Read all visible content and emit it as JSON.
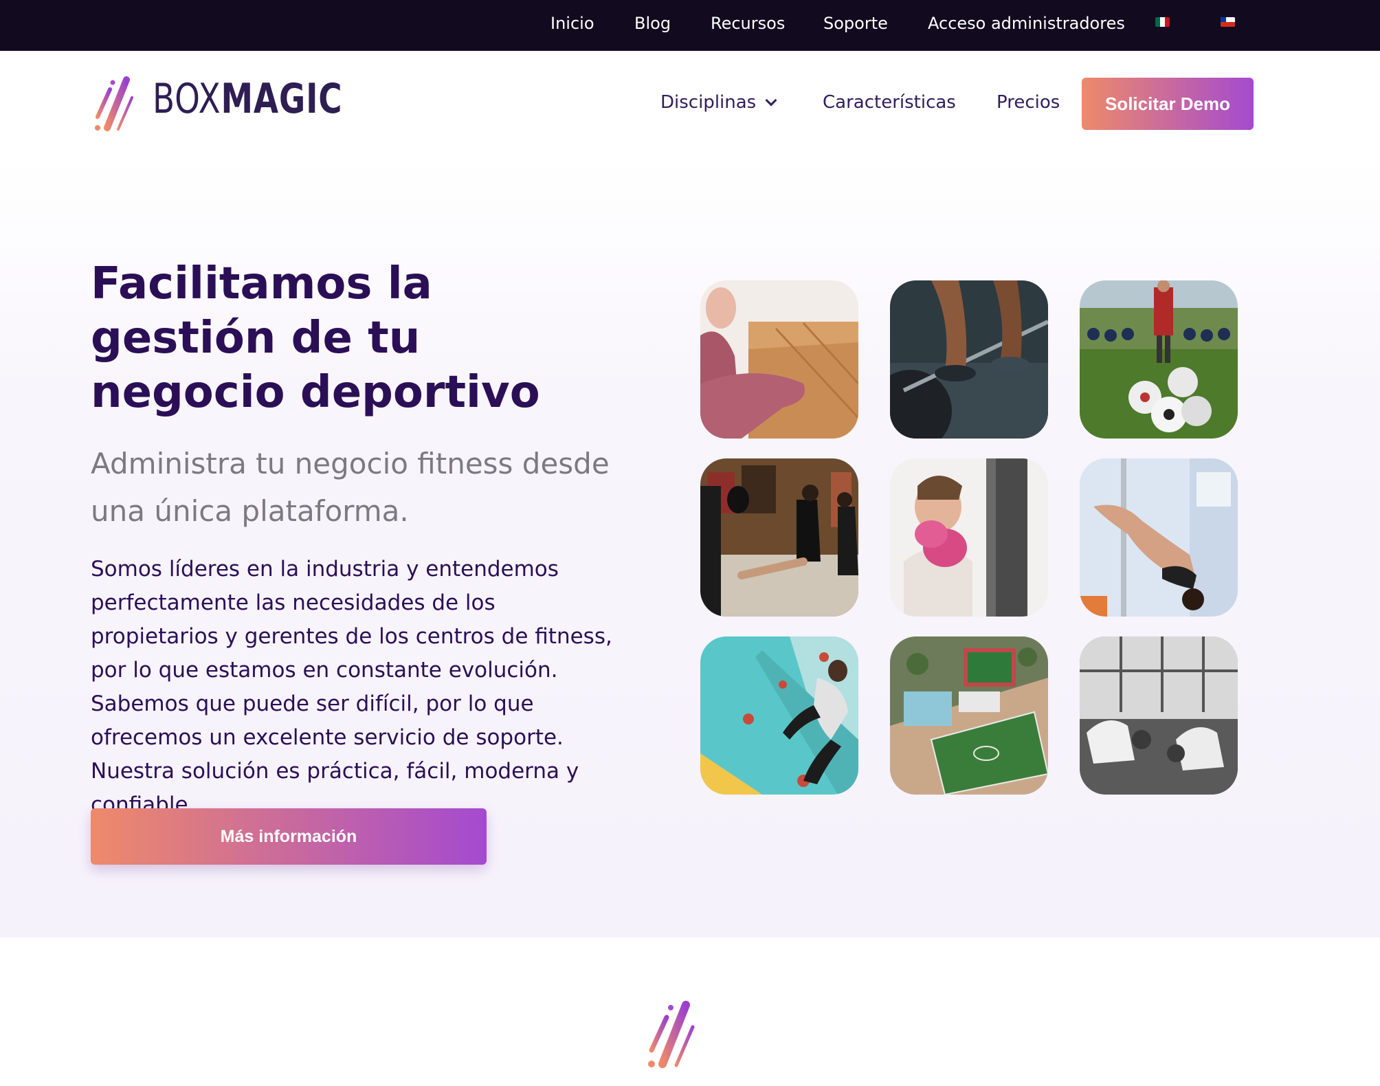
{
  "topbar": {
    "links": [
      "Inicio",
      "Blog",
      "Recursos",
      "Soporte",
      "Acceso administradores"
    ],
    "flags": [
      "mexico-flag-icon",
      "chile-flag-icon"
    ]
  },
  "header": {
    "logo": {
      "light": "BOX",
      "bold": "MAGIC"
    },
    "nav": {
      "disciplinas": "Disciplinas",
      "caracteristicas": "Características",
      "precios": "Precios"
    },
    "cta": "Solicitar Demo"
  },
  "hero": {
    "title": "Facilitamos la gestión de tu negocio deportivo",
    "subtitle": "Administra tu negocio fitness desde una única plataforma.",
    "body": "Somos líderes en la industria y entendemos perfectamente las necesidades de los propietarios y gerentes de los centros de fitness, por lo que estamos en constante evolución. Sabemos que puede ser difícil, por lo que ofrecemos un excelente servicio de soporte. Nuestra solución es práctica, fácil, moderna y confiable.",
    "button": "Más información"
  },
  "gallery": [
    "yoga",
    "weightlifting",
    "football",
    "kickboxing",
    "boxing",
    "pole-dance",
    "climbing",
    "sports-complex",
    "martial-arts"
  ],
  "colors": {
    "accent_start": "#ee8a6a",
    "accent_end": "#a44ad0",
    "navy": "#2b0f56",
    "topbar": "#120a1f"
  }
}
